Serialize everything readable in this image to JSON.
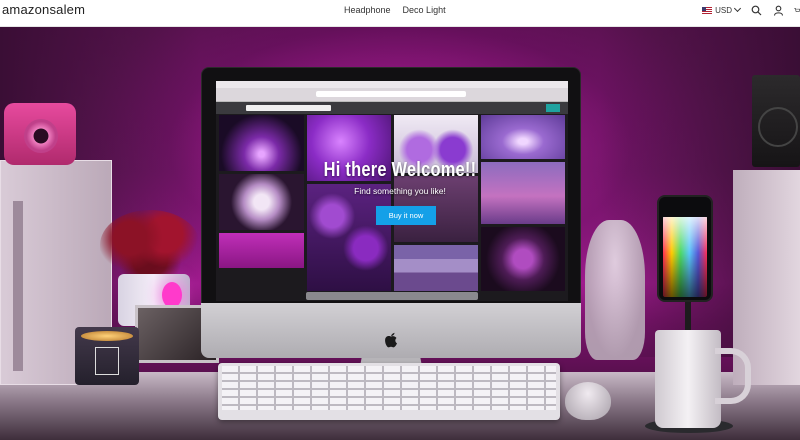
{
  "header": {
    "logo": "amazonsalem",
    "nav": [
      "Headphone",
      "Deco Light"
    ],
    "currency": "USD"
  },
  "icons": {
    "flag": "us-flag-icon",
    "currency_toggle": "chevron-down-icon",
    "search": "search-icon",
    "account": "user-icon",
    "cart": "cart-icon",
    "apple": "apple-logo"
  },
  "hero": {
    "title": "Hi there Welcome!!",
    "subtitle": "Find something you like!",
    "button_label": "Buy it now"
  },
  "colors": {
    "header_bg": "#ffffff",
    "button_bg": "#14a0e8",
    "scene_glow": "#d11fb8",
    "text": "#ffffff"
  }
}
